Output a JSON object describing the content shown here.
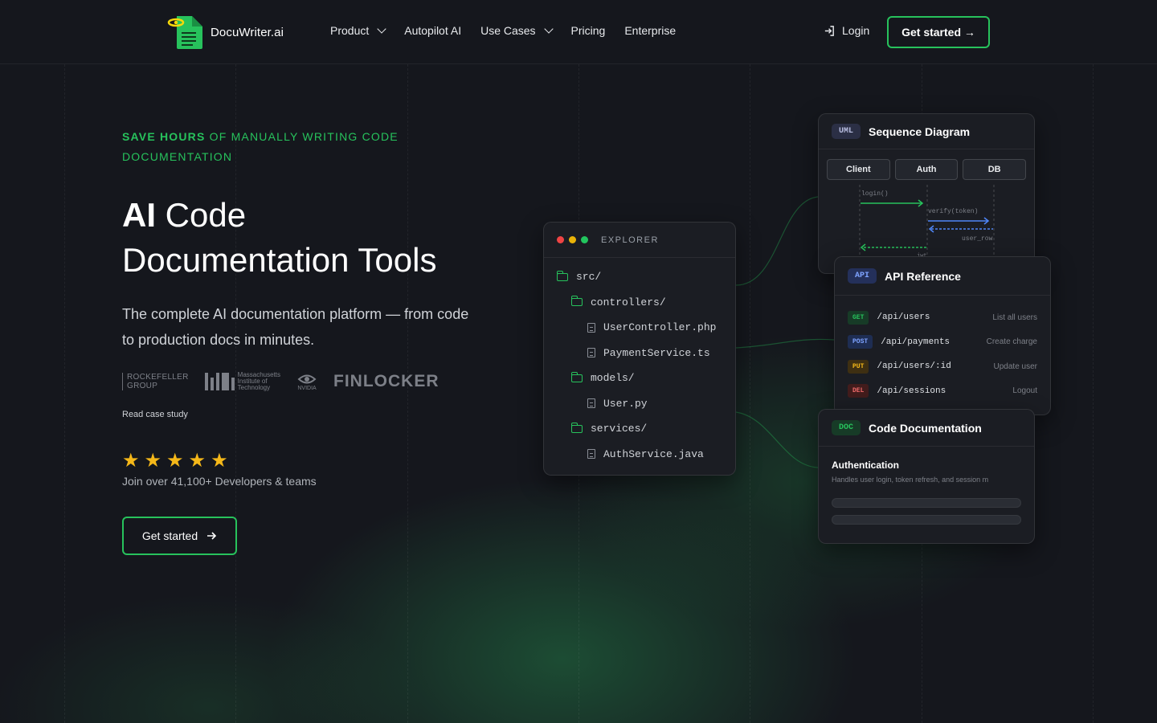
{
  "nav": {
    "brand": "DocuWriter.ai",
    "links": [
      {
        "label": "Product",
        "has_dropdown": true
      },
      {
        "label": "Autopilot AI",
        "has_dropdown": false
      },
      {
        "label": "Use Cases",
        "has_dropdown": true
      },
      {
        "label": "Pricing",
        "has_dropdown": false
      },
      {
        "label": "Enterprise",
        "has_dropdown": false
      }
    ],
    "login": "Login",
    "cta": "Get started →"
  },
  "hero": {
    "eyebrow_bold": "SAVE HOURS",
    "eyebrow_rest": " OF MANUALLY WRITING CODE DOCUMENTATION",
    "title_bold": "AI",
    "title_line1_rest": " Code",
    "title_line2": "Documentation Tools",
    "subtitle": "The complete AI documentation platform — from code to production docs in minutes.",
    "logos": {
      "rockefeller_1": "ROCKEFELLER",
      "rockefeller_2": "GROUP",
      "mit_1": "Massachusetts",
      "mit_2": "Institute of",
      "mit_3": "Technology",
      "nvidia": "NVIDIA",
      "finlocker": "FINLOCKER"
    },
    "case_study": "Read case study",
    "rating": 5,
    "join_text": "Join over 41,100+ Developers & teams",
    "cta": "Get started"
  },
  "explorer": {
    "title": "EXPLORER",
    "dot_colors": [
      "#ef4444",
      "#eab308",
      "#22c55e"
    ],
    "items": [
      {
        "name": "src/",
        "type": "folder",
        "depth": 0
      },
      {
        "name": "controllers/",
        "type": "folder",
        "depth": 1
      },
      {
        "name": "UserController.php",
        "type": "file",
        "depth": 2
      },
      {
        "name": "PaymentService.ts",
        "type": "file",
        "depth": 2
      },
      {
        "name": "models/",
        "type": "folder",
        "depth": 1
      },
      {
        "name": "User.py",
        "type": "file",
        "depth": 2
      },
      {
        "name": "services/",
        "type": "folder",
        "depth": 1
      },
      {
        "name": "AuthService.java",
        "type": "file",
        "depth": 2
      }
    ]
  },
  "uml": {
    "tag": "UML",
    "title": "Sequence Diagram",
    "actors": [
      "Client",
      "Auth",
      "DB"
    ],
    "messages": [
      "login()",
      "verify(token)",
      "user_row",
      "jwt"
    ]
  },
  "api": {
    "tag": "API",
    "title": "API Reference",
    "endpoints": [
      {
        "method": "GET",
        "path": "/api/users",
        "desc": "List all users",
        "color": "#22c55e"
      },
      {
        "method": "POST",
        "path": "/api/payments",
        "desc": "Create charge",
        "color": "#60a5fa"
      },
      {
        "method": "PUT",
        "path": "/api/users/:id",
        "desc": "Update user",
        "color": "#f59e0b"
      },
      {
        "method": "DEL",
        "path": "/api/sessions",
        "desc": "Logout",
        "color": "#ef4444"
      }
    ]
  },
  "doc": {
    "tag": "DOC",
    "title": "Code Documentation",
    "heading": "Authentication",
    "text": "Handles user login, token refresh, and session m"
  },
  "colors": {
    "accent": "#27c25c",
    "background": "#15171d",
    "card": "#1b1d23",
    "star": "#f5b819"
  }
}
